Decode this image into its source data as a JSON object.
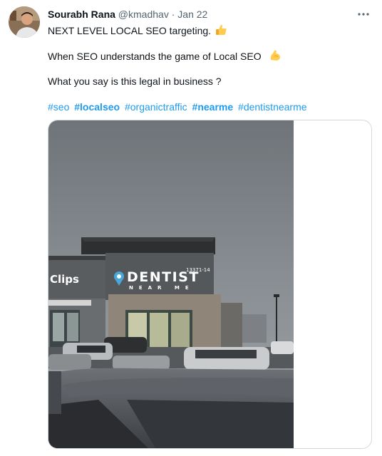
{
  "tweet": {
    "author_name": "Sourabh Rana",
    "author_handle": "@kmadhav",
    "separator": "·",
    "date": "Jan 22",
    "more_icon": "more-horizontal-icon",
    "lines": [
      "NEXT LEVEL LOCAL SEO targeting.",
      "When SEO understands the game of Local SEO",
      "What you say is this legal in business ?"
    ],
    "emojis": [
      "thumbs-up-emoji",
      "flexed-biceps-emoji"
    ],
    "hashtags": [
      {
        "text": "#seo",
        "bold": false
      },
      {
        "text": "#localseo",
        "bold": true
      },
      {
        "text": "#organictraffic",
        "bold": false
      },
      {
        "text": "#nearme",
        "bold": true
      },
      {
        "text": "#dentistnearme",
        "bold": false
      }
    ]
  },
  "photo": {
    "sign_main": "DENTIST",
    "sign_sub": "NEAR ME",
    "address": "13371-14",
    "store_sign": "Clips"
  },
  "colors": {
    "link": "#1d9bf0",
    "text": "#0f1419",
    "muted": "#536471",
    "border": "#cfd9de"
  }
}
